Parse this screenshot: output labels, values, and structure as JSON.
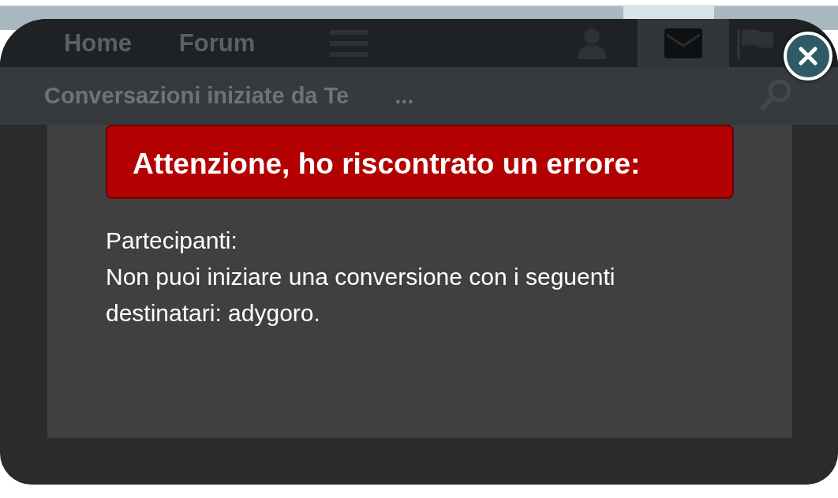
{
  "nav": {
    "items": [
      {
        "kind": "text",
        "label": "Home",
        "selected": false
      },
      {
        "kind": "text",
        "label": "Forum",
        "selected": false
      },
      {
        "kind": "menu",
        "selected": false
      },
      {
        "kind": "user",
        "selected": false
      },
      {
        "kind": "mail",
        "selected": true
      },
      {
        "kind": "flag",
        "selected": false
      }
    ]
  },
  "subheader": {
    "title": "Conversazioni iniziate da Te",
    "more": "..."
  },
  "dialog": {
    "error_title": "Attenzione, ho riscontrato un errore:",
    "lines": [
      "Partecipanti:",
      "Non puoi iniziare una conversione con i seguenti destinatari: adygoro."
    ]
  }
}
